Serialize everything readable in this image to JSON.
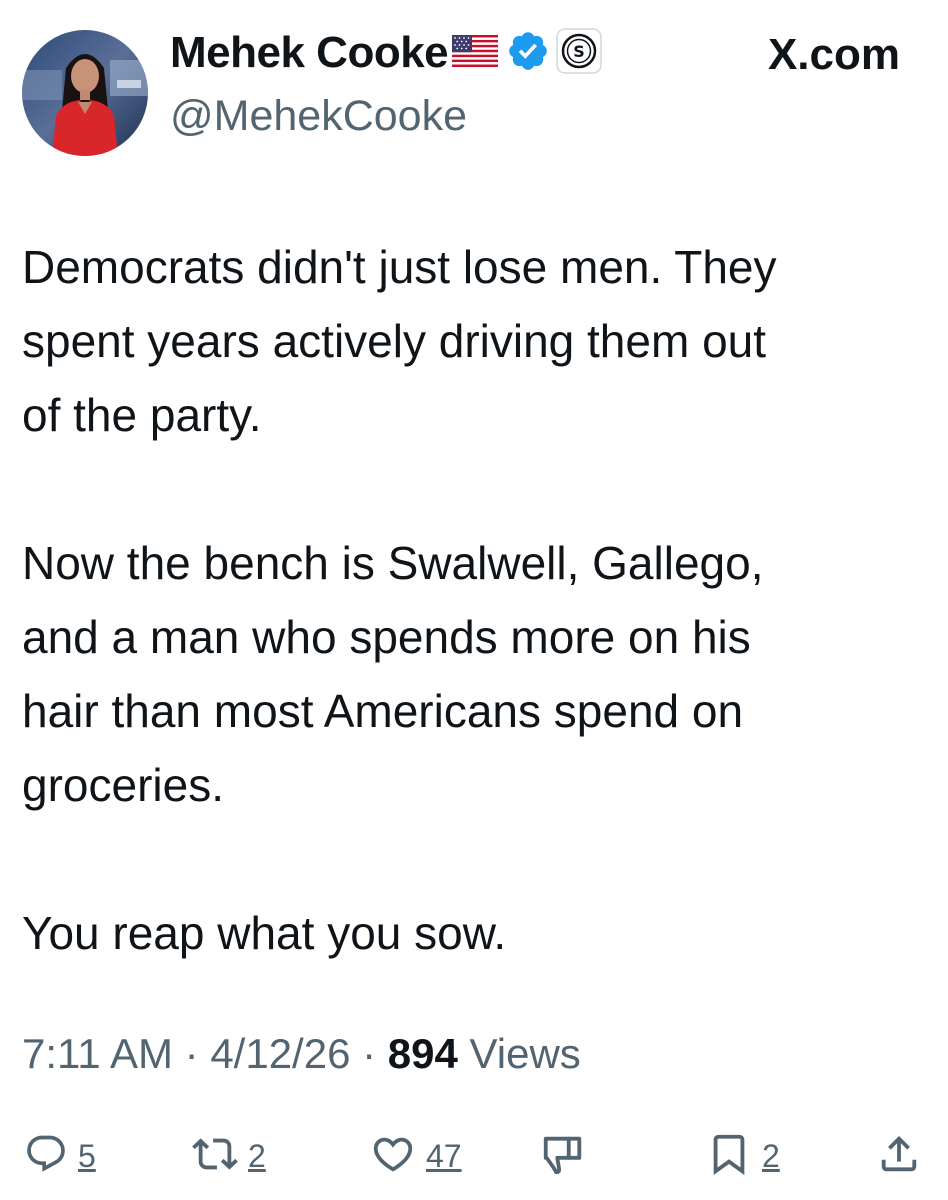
{
  "header": {
    "display_name": "Mehek Cooke",
    "flag_icon": "us-flag-icon",
    "verified_icon": "verified-badge-icon",
    "affiliate_icon": "circle-s-badge-icon",
    "handle": "@MehekCooke",
    "site_label": "X.com"
  },
  "tweet": {
    "paragraphs": [
      [
        "Democrats didn't just lose men. They",
        "spent years actively driving them out",
        "of the party."
      ],
      [
        "Now the bench is Swalwell, Gallego,",
        "and a man who spends more on his",
        "hair than most Americans spend on",
        "groceries."
      ],
      [
        "You reap what you sow."
      ]
    ]
  },
  "meta": {
    "time": "7:11 AM",
    "separator": " · ",
    "date": "4/12/26",
    "views_count": "894",
    "views_label": "Views"
  },
  "actions": {
    "reply": {
      "icon": "reply-icon",
      "count": "5"
    },
    "repost": {
      "icon": "repost-icon",
      "count": "2"
    },
    "like": {
      "icon": "heart-icon",
      "count": "47"
    },
    "dislike": {
      "icon": "thumbs-down-icon"
    },
    "bookmark": {
      "icon": "bookmark-icon",
      "count": "2"
    },
    "share": {
      "icon": "share-icon"
    }
  },
  "colors": {
    "text": "#0f1419",
    "secondary": "#536471",
    "verified": "#1d9bf0",
    "background": "#ffffff"
  }
}
